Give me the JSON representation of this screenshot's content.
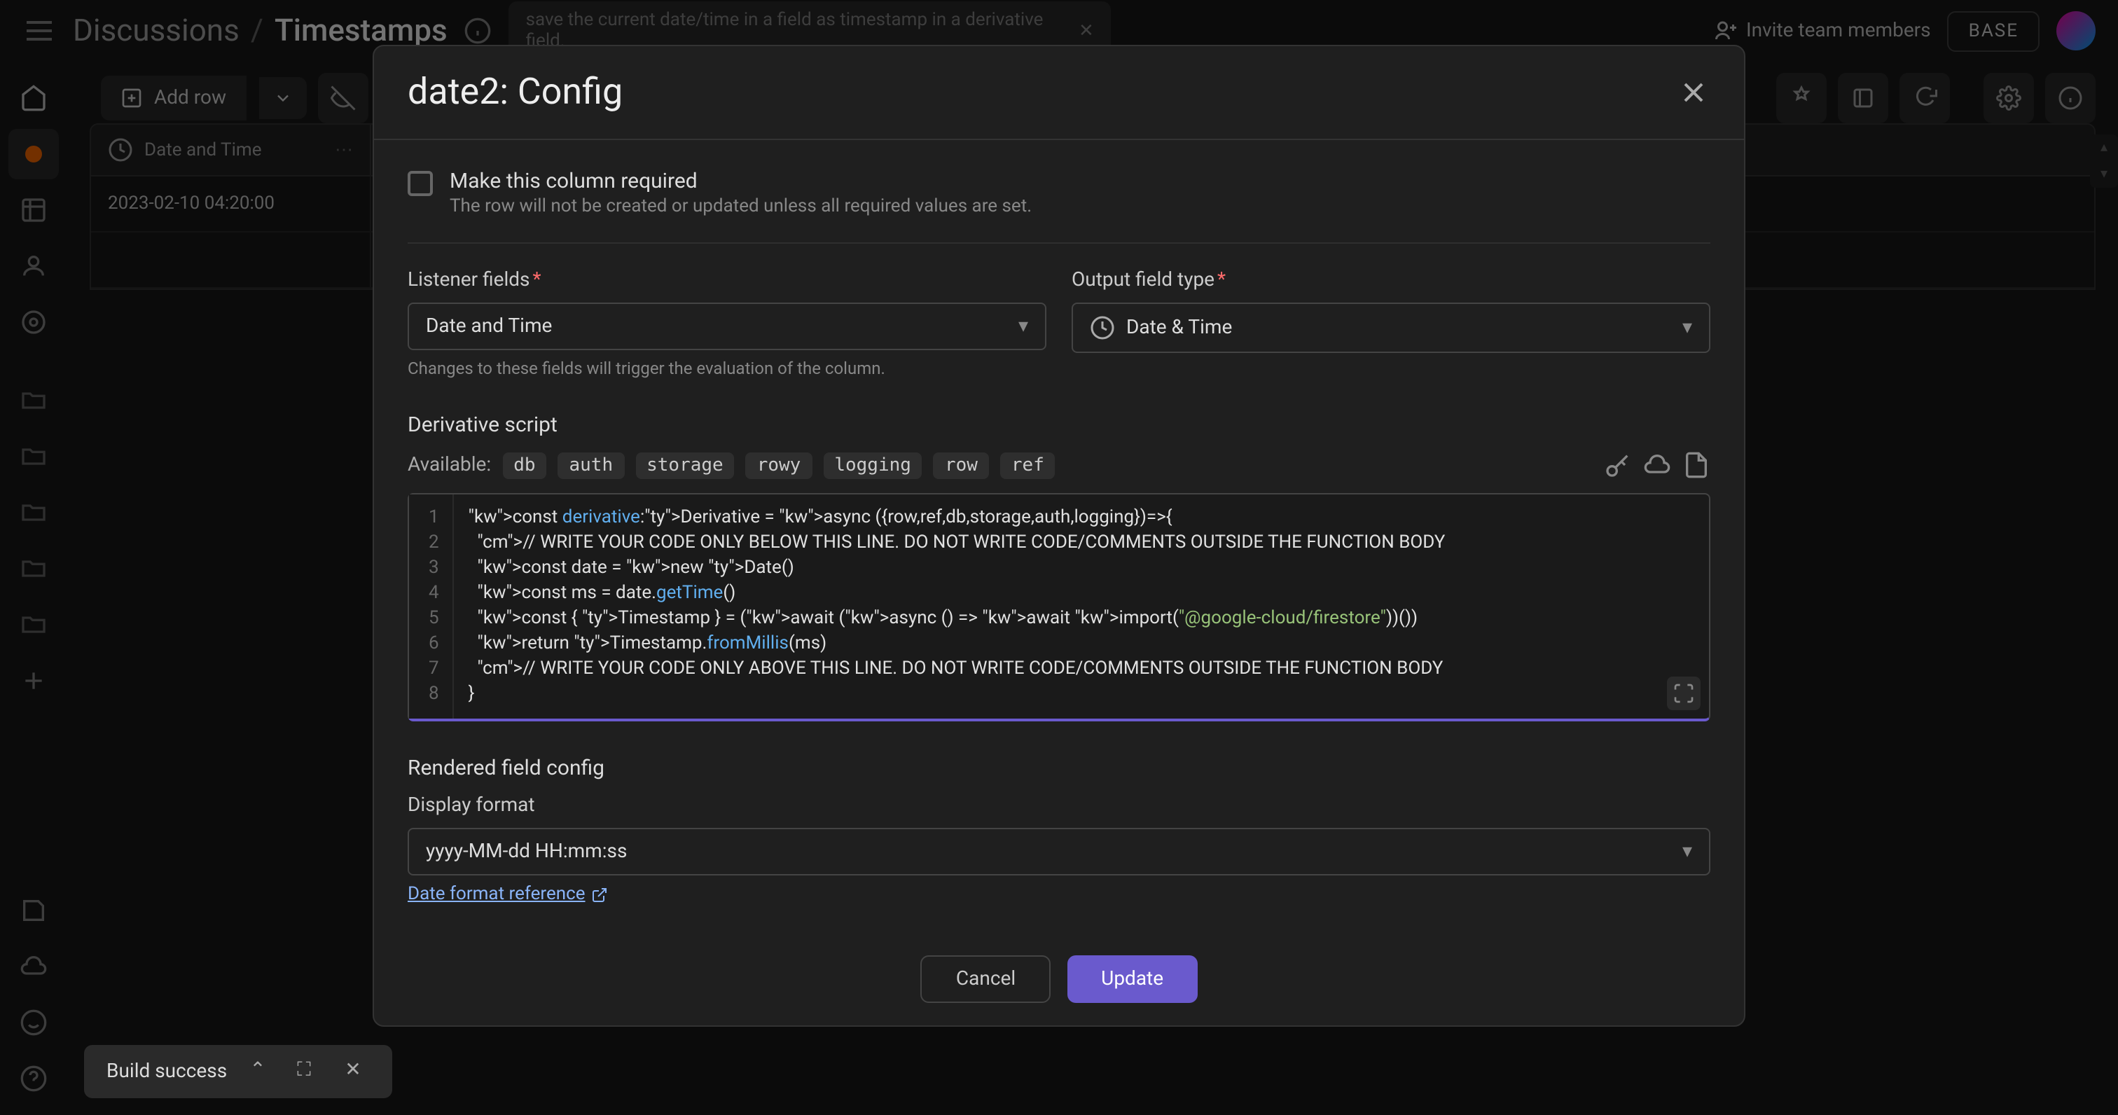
{
  "breadcrumb": {
    "parent": "Discussions",
    "current": "Timestamps"
  },
  "search_text": "save the current date/time in a field as timestamp in a derivative field.",
  "invite_label": "Invite team members",
  "base_label": "BASE",
  "add_row_label": "Add row",
  "table": {
    "columns": [
      {
        "label": "Date and Time"
      }
    ],
    "rows": [
      {
        "date": "2023-02-10 04:20:00"
      },
      {
        "date": ""
      }
    ]
  },
  "modal": {
    "title": "date2: Config",
    "required_title": "Make this column required",
    "required_sub": "The row will not be created or updated unless all required values are set.",
    "listener_label": "Listener fields",
    "listener_value": "Date and Time",
    "listener_hint": "Changes to these fields will trigger the evaluation of the column.",
    "output_label": "Output field type",
    "output_value": "Date & Time",
    "script_label": "Derivative script",
    "available_label": "Available:",
    "available": [
      "db",
      "auth",
      "storage",
      "rowy",
      "logging",
      "row",
      "ref"
    ],
    "code_lines": [
      "const derivative:Derivative = async ({row,ref,db,storage,auth,logging})=>{",
      "  // WRITE YOUR CODE ONLY BELOW THIS LINE. DO NOT WRITE CODE/COMMENTS OUTSIDE THE FUNCTION BODY",
      "  const date = new Date()",
      "  const ms = date.getTime()",
      "  const { Timestamp } = (await (async () => await import(\"@google-cloud/firestore\"))())",
      "  return Timestamp.fromMillis(ms)",
      "  // WRITE YOUR CODE ONLY ABOVE THIS LINE. DO NOT WRITE CODE/COMMENTS OUTSIDE THE FUNCTION BODY",
      "}"
    ],
    "rendered_label": "Rendered field config",
    "display_format_label": "Display format",
    "display_format_value": "yyyy-MM-dd HH:mm:ss",
    "format_link": "Date format reference",
    "cancel": "Cancel",
    "update": "Update"
  },
  "toast": {
    "msg": "Build success"
  }
}
